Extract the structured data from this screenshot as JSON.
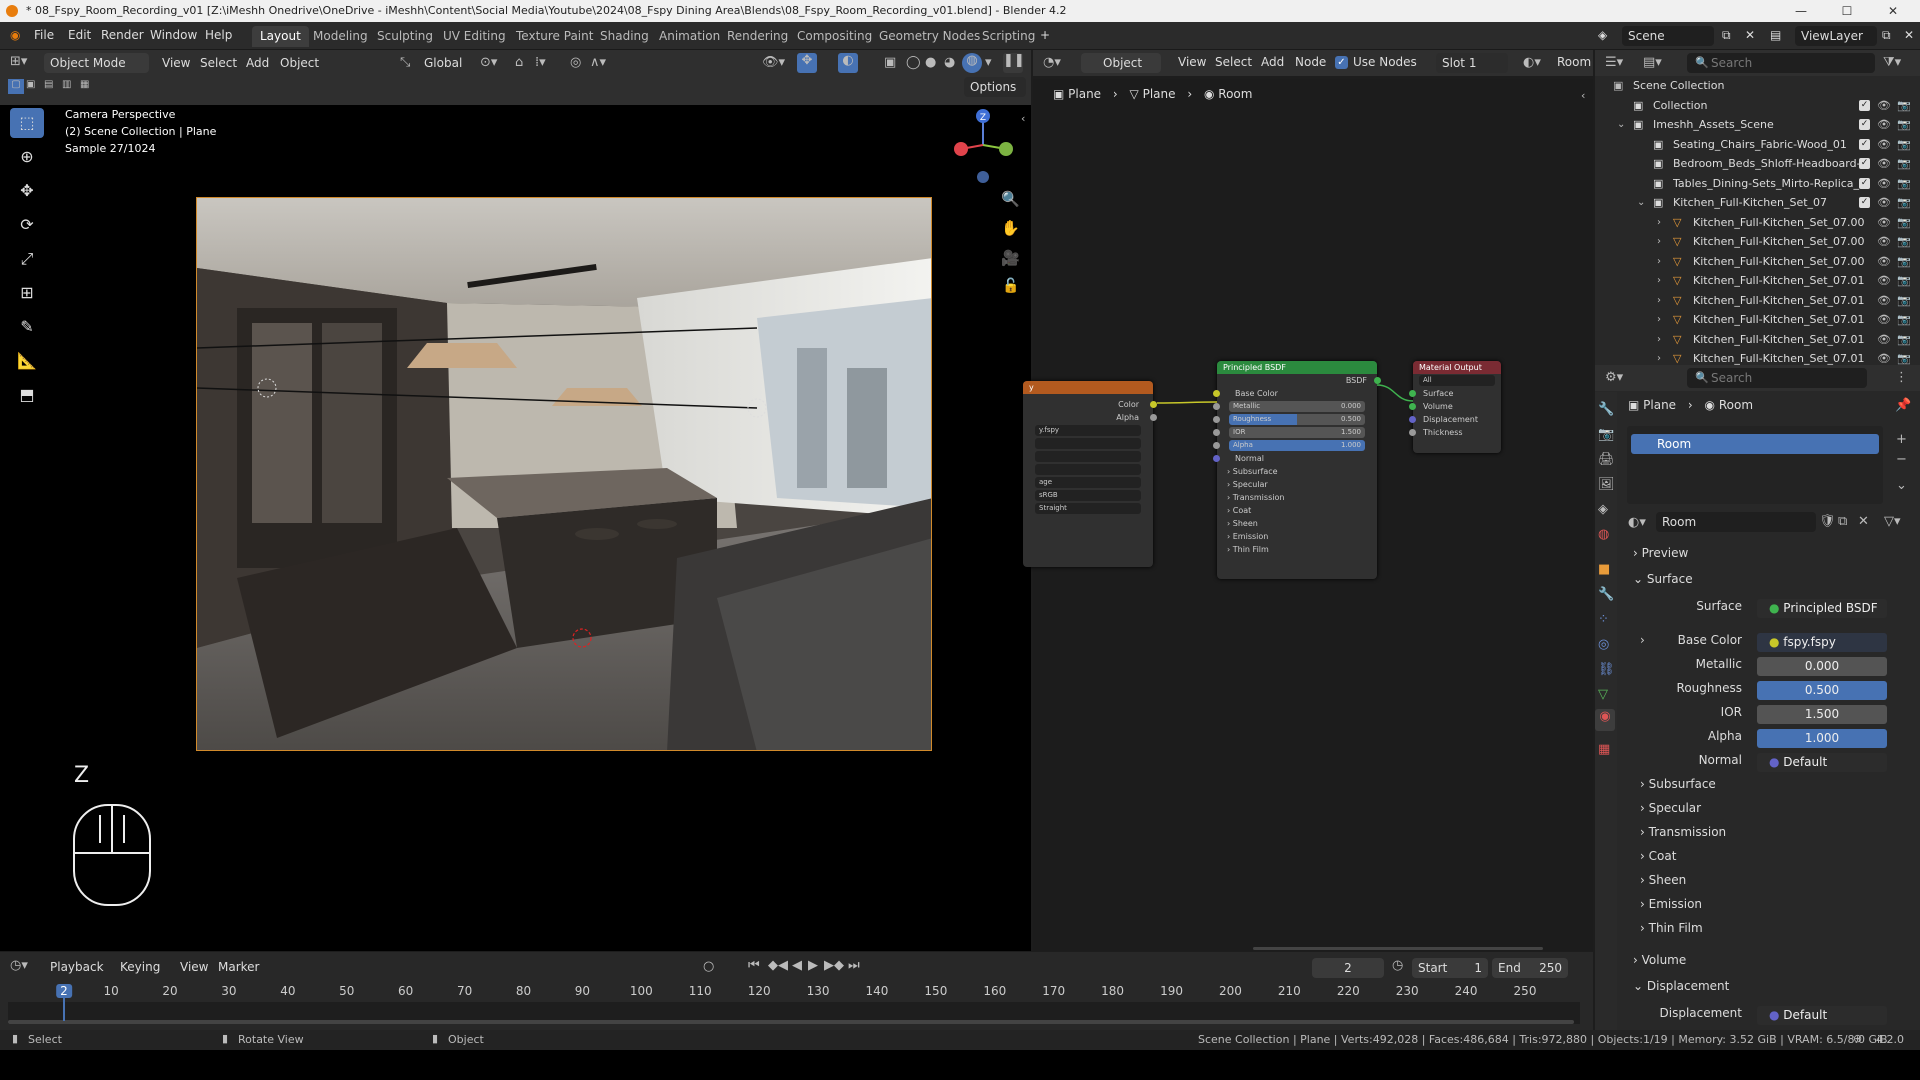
{
  "title_bar": {
    "text": "* 08_Fspy_Room_Recording_v01 [Z:\\iMeshh Onedrive\\OneDrive - iMeshh\\Content\\Social Media\\Youtube\\2024\\08_Fspy Dining Area\\Blends\\08_Fspy_Room_Recording_v01.blend] - Blender 4.2"
  },
  "menu": [
    "File",
    "Edit",
    "Render",
    "Window",
    "Help"
  ],
  "workspaces": [
    "Layout",
    "Modeling",
    "Sculpting",
    "UV Editing",
    "Texture Paint",
    "Shading",
    "Animation",
    "Rendering",
    "Compositing",
    "Geometry Nodes",
    "Scripting"
  ],
  "scene": {
    "name": "Scene",
    "view_layer": "ViewLayer"
  },
  "viewport_header": {
    "mode": "Object Mode",
    "items": [
      "View",
      "Select",
      "Add",
      "Object"
    ],
    "orientation": "Global",
    "options": "Options"
  },
  "viewport_overlay": {
    "line1": "Camera Perspective",
    "line2": "(2) Scene Collection | Plane",
    "line3": "Sample 27/1024",
    "key": "Z"
  },
  "node_header": {
    "object": "Object",
    "items": [
      "View",
      "Select",
      "Add",
      "Node"
    ],
    "use_nodes": "Use Nodes",
    "slot": "Slot 1",
    "material": "Room"
  },
  "node_breadcrumb": [
    "Plane",
    "Plane",
    "Room"
  ],
  "image_node": {
    "fields": [
      "y.fspy",
      "",
      "",
      "",
      "age",
      "sRGB",
      "Straight"
    ],
    "outputs": [
      "Color",
      "Alpha"
    ],
    "title": "y"
  },
  "bsdf_node": {
    "title": "Principled BSDF",
    "out": "BSDF",
    "base_color": "Base Color",
    "metallic": "Metallic",
    "metallic_v": "0.000",
    "roughness": "Roughness",
    "roughness_v": "0.500",
    "ior": "IOR",
    "ior_v": "1.500",
    "alpha": "Alpha",
    "alpha_v": "1.000",
    "normal": "Normal",
    "panels": [
      "Subsurface",
      "Specular",
      "Transmission",
      "Coat",
      "Sheen",
      "Emission",
      "Thin Film"
    ]
  },
  "output_node": {
    "title": "Material Output",
    "target": "All",
    "inputs": [
      "Surface",
      "Volume",
      "Displacement",
      "Thickness"
    ]
  },
  "outliner": {
    "search": "Search",
    "root": "Scene Collection",
    "rows": [
      {
        "label": "Collection",
        "indent": 1,
        "type": "collection"
      },
      {
        "label": "Imeshh_Assets_Scene",
        "indent": 1,
        "type": "collection"
      },
      {
        "label": "Seating_Chairs_Fabric-Wood_01",
        "indent": 2,
        "type": "collection"
      },
      {
        "label": "Bedroom_Beds_Shloff-Headboard-C",
        "indent": 2,
        "type": "collection"
      },
      {
        "label": "Tables_Dining-Sets_Mirto-Replica_C",
        "indent": 2,
        "type": "collection"
      },
      {
        "label": "Kitchen_Full-Kitchen_Set_07",
        "indent": 2,
        "type": "collection"
      },
      {
        "label": "Kitchen_Full-Kitchen_Set_07.00",
        "indent": 3,
        "type": "mesh"
      },
      {
        "label": "Kitchen_Full-Kitchen_Set_07.00",
        "indent": 3,
        "type": "mesh"
      },
      {
        "label": "Kitchen_Full-Kitchen_Set_07.00",
        "indent": 3,
        "type": "mesh"
      },
      {
        "label": "Kitchen_Full-Kitchen_Set_07.01",
        "indent": 3,
        "type": "mesh"
      },
      {
        "label": "Kitchen_Full-Kitchen_Set_07.01",
        "indent": 3,
        "type": "mesh"
      },
      {
        "label": "Kitchen_Full-Kitchen_Set_07.01",
        "indent": 3,
        "type": "mesh"
      },
      {
        "label": "Kitchen_Full-Kitchen_Set_07.01",
        "indent": 3,
        "type": "mesh"
      },
      {
        "label": "Kitchen_Full-Kitchen_Set_07.01",
        "indent": 3,
        "type": "mesh"
      }
    ]
  },
  "properties": {
    "search": "Search",
    "breadcrumb": [
      "Plane",
      "Room"
    ],
    "material_slot": "Room",
    "material_name": "Room",
    "sections": {
      "preview": "Preview",
      "surface": "Surface",
      "volume": "Volume",
      "displacement": "Displacement"
    },
    "surface_label": "Surface",
    "surface_value": "Principled BSDF",
    "base_color_label": "Base Color",
    "base_color_value": "fspy.fspy",
    "metallic_label": "Metallic",
    "metallic_value": "0.000",
    "roughness_label": "Roughness",
    "roughness_value": "0.500",
    "ior_label": "IOR",
    "ior_value": "1.500",
    "alpha_label": "Alpha",
    "alpha_value": "1.000",
    "normal_label": "Normal",
    "normal_value": "Default",
    "subpanels": [
      "Subsurface",
      "Specular",
      "Transmission",
      "Coat",
      "Sheen",
      "Emission",
      "Thin Film"
    ],
    "displacement_label": "Displacement",
    "displacement_value": "Default"
  },
  "timeline": {
    "menus": [
      "Playback",
      "Keying",
      "View",
      "Marker"
    ],
    "current_frame": "2",
    "start_label": "Start",
    "start": "1",
    "end_label": "End",
    "end": "250",
    "ticks": [
      "2",
      "10",
      "20",
      "30",
      "40",
      "50",
      "60",
      "70",
      "80",
      "90",
      "100",
      "110",
      "120",
      "130",
      "140",
      "150",
      "160",
      "170",
      "180",
      "190",
      "200",
      "210",
      "220",
      "230",
      "240",
      "250"
    ]
  },
  "status": {
    "select": "Select",
    "rotate": "Rotate View",
    "object": "Object",
    "stats": "Scene Collection | Plane | Verts:492,028 | Faces:486,684 | Tris:972,880 | Objects:1/19 | Memory: 3.52 GiB | VRAM: 6.5/8.0 GiB",
    "version": "4.2.0"
  },
  "colors": {
    "accent": "#4772b3",
    "camera_frame": "#d18a2b",
    "bsdf_header": "#2b8a3e",
    "output_header": "#7a2b33",
    "image_header": "#b35a1f"
  }
}
